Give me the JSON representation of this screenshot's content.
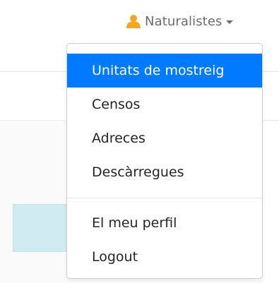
{
  "navbar": {
    "user_menu_label": "Naturalistes",
    "user_icon": "user-icon",
    "user_icon_color": "#f5a623"
  },
  "dropdown": {
    "active_color": "#007bff",
    "items": [
      {
        "label": "Unitats de mostreig",
        "active": true
      },
      {
        "label": "Censos"
      },
      {
        "label": "Adreces"
      },
      {
        "label": "Descàrregues"
      }
    ],
    "account_items": [
      {
        "label": "El meu perfil"
      },
      {
        "label": "Logout"
      }
    ]
  }
}
